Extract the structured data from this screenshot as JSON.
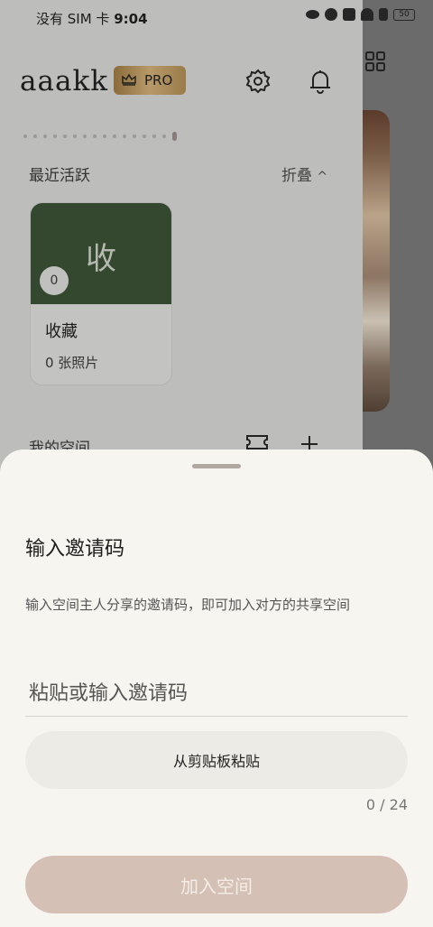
{
  "status_bar": {
    "carrier": "没有 SIM 卡",
    "time": "9:04",
    "battery": "50"
  },
  "header": {
    "brand": "aaakk",
    "pro_badge": "PRO"
  },
  "recent": {
    "title": "最近活跃",
    "fold_label": "折叠",
    "fold_chevron": "^"
  },
  "album_card": {
    "cover_char": "收",
    "count_badge": "0",
    "name": "收藏",
    "photo_count": "0 张照片"
  },
  "my_space": {
    "title": "我的空间"
  },
  "sheet": {
    "title": "输入邀请码",
    "description": "输入空间主人分享的邀请码，即可加入对方的共享空间",
    "input_placeholder": "粘贴或输入邀请码",
    "paste_button": "从剪贴板粘贴",
    "counter": "0 / 24",
    "join_button": "加入空间"
  },
  "colors": {
    "sheet_bg": "#f7f5f0",
    "join_button": "#d5c0b5",
    "album_cover": "#33482f"
  },
  "icons": [
    "eye-icon",
    "alarm-icon",
    "mute-icon",
    "wifi-icon",
    "alert-icon",
    "battery-icon",
    "gear-icon",
    "bell-icon",
    "grid-icon",
    "crown-icon",
    "ticket-icon",
    "plus-icon"
  ]
}
